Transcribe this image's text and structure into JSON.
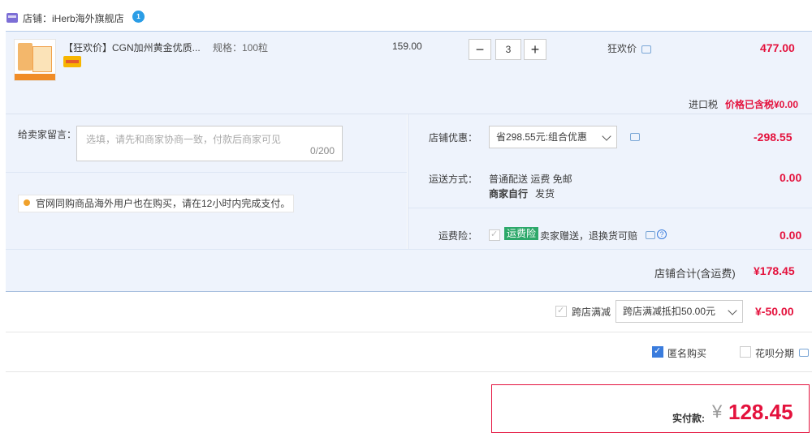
{
  "store": {
    "label": "店铺：iHerb海外旗舰店",
    "ww_badge": "1"
  },
  "item": {
    "title": "【狂欢价】CGN加州黄金优质...",
    "spec": "规格：100粒",
    "unit_price": "159.00",
    "qty": "3",
    "minus": "−",
    "plus": "+",
    "promo_label": "狂欢价",
    "subtotal": "477.00",
    "tax_label": "进口税",
    "tax_value": "价格已含税¥0.00"
  },
  "message": {
    "label": "给卖家留言：",
    "placeholder": "选填，请先和商家协商一致，付款后商家可见",
    "counter": "0/200",
    "tip": "官网同购商品海外用户也在购买，请在12小时内完成支付。"
  },
  "shop_discount": {
    "label": "店铺优惠：",
    "selected": "省298.55元:组合优惠",
    "value": "-298.55"
  },
  "shipping": {
    "label": "运送方式：",
    "line1": "普通配送 运费 免邮",
    "line2_bold": "商家自行",
    "line2_rest": "发货",
    "value": "0.00"
  },
  "insurance": {
    "label": "运费险：",
    "tag": "运费险",
    "text": "卖家赠送，退换货可赔",
    "value": "0.00"
  },
  "store_total": {
    "label": "店铺合计(含运费)",
    "value": "¥178.45"
  },
  "cross_store": {
    "label": "跨店满减",
    "selected": "跨店满减抵扣50.00元",
    "value": "¥-50.00"
  },
  "options": {
    "anonymous": "匿名购买",
    "installment": "花呗分期"
  },
  "payable": {
    "label": "实付款:",
    "currency": "¥",
    "amount": "128.45"
  },
  "colors": {
    "accent_red": "#e4123d",
    "panel_bg": "#eef3fc",
    "check_blue": "#3a7cdd",
    "tag_green": "#2ca86a"
  }
}
